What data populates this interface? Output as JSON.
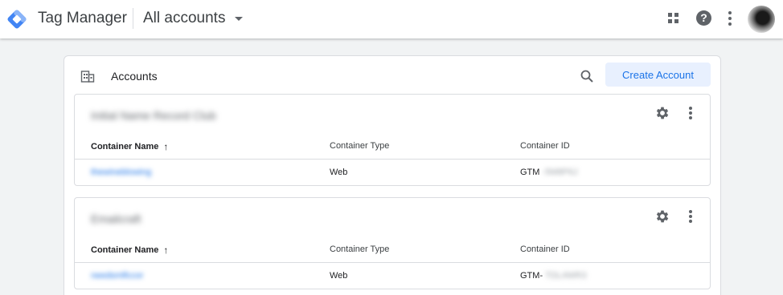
{
  "topbar": {
    "app_title": "Tag Manager",
    "account_picker_label": "All accounts",
    "brand_color": "#4285f4",
    "icons": [
      "tag-manager-logo-icon",
      "apps-grid-icon",
      "help-icon",
      "more-vert-icon",
      "avatar"
    ]
  },
  "accounts_panel": {
    "title": "Accounts",
    "create_button_label": "Create Account",
    "icons": [
      "accounts-building-icon",
      "search-icon"
    ]
  },
  "account_cards": [
    {
      "account_name": "Initial Name Record Club",
      "columns": [
        "Container Name",
        "Container Type",
        "Container ID"
      ],
      "sort_indicator": "↑",
      "rows": [
        {
          "container_name": "thewineblowing",
          "container_type": "Web",
          "container_id_prefix": "GTM",
          "container_id_rest": "-5M8P6J"
        }
      ]
    },
    {
      "account_name": "Emailcraft",
      "columns": [
        "Container Name",
        "Container Type",
        "Container ID"
      ],
      "sort_indicator": "↑",
      "rows": [
        {
          "container_name": "needsmlfccor",
          "container_type": "Web",
          "container_id_prefix": "GTM-",
          "container_id_rest": "TDL4WR3"
        }
      ]
    }
  ]
}
